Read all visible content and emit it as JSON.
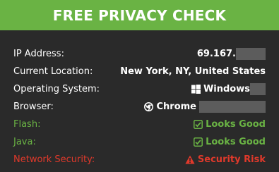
{
  "header": {
    "title": "FREE PRIVACY CHECK"
  },
  "rows": {
    "ip": {
      "label": "IP Address:",
      "value": "69.167."
    },
    "location": {
      "label": "Current Location:",
      "value": "New York, NY, United States"
    },
    "os": {
      "label": "Operating System:",
      "value": "Windows",
      "icon": "windows-icon"
    },
    "browser": {
      "label": "Browser:",
      "value": "Chrome",
      "icon": "chrome-icon"
    },
    "flash": {
      "label": "Flash:",
      "value": "Looks Good",
      "icon": "check-square-icon"
    },
    "java": {
      "label": "Java:",
      "value": "Looks Good",
      "icon": "check-square-icon"
    },
    "network": {
      "label": "Network Security:",
      "value": "Security Risk",
      "icon": "warning-icon"
    }
  },
  "colors": {
    "header_bg": "#6ab344",
    "panel_bg": "#2a2a2a",
    "good": "#6ab344",
    "risk": "#e0392b",
    "redaction": "#5c5c5c"
  }
}
